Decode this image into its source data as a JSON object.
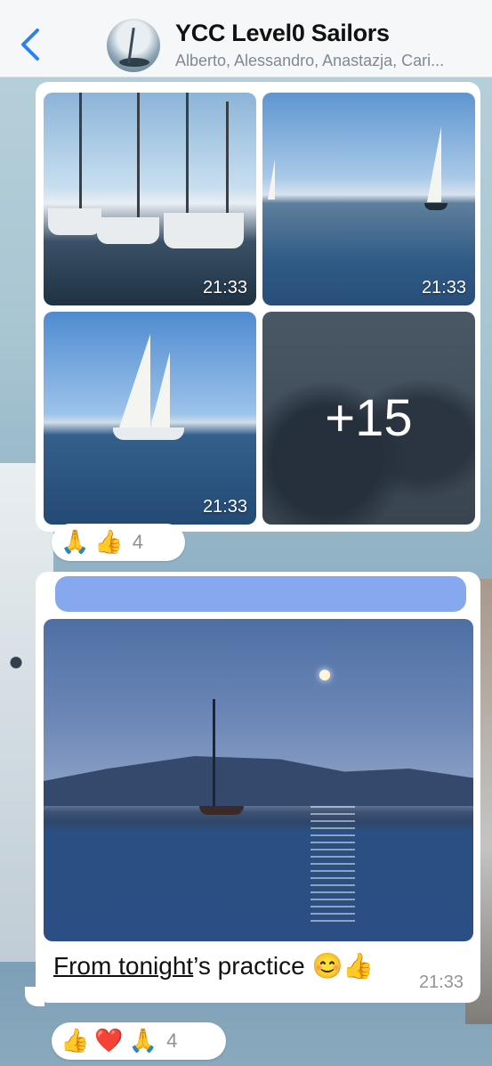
{
  "header": {
    "back_icon": "chevron-left-icon",
    "title": "YCC Level0 Sailors",
    "subtitle": "Alberto, Alessandro, Anastazja, Cari..."
  },
  "album": {
    "photos": [
      {
        "time": "21:33"
      },
      {
        "time": "21:33"
      },
      {
        "time": "21:33"
      },
      {
        "more": "+15"
      }
    ],
    "reactions": [
      "🙏",
      "👍"
    ],
    "reaction_count": "4"
  },
  "message": {
    "caption_link": "From tonight",
    "caption_rest": "’s practice 😊👍",
    "time": "21:33",
    "reactions": [
      "👍",
      "❤️",
      "🙏"
    ],
    "reaction_count": "4"
  },
  "colors": {
    "accent": "#2f80ed",
    "quote_bar": "#86a8ee"
  }
}
